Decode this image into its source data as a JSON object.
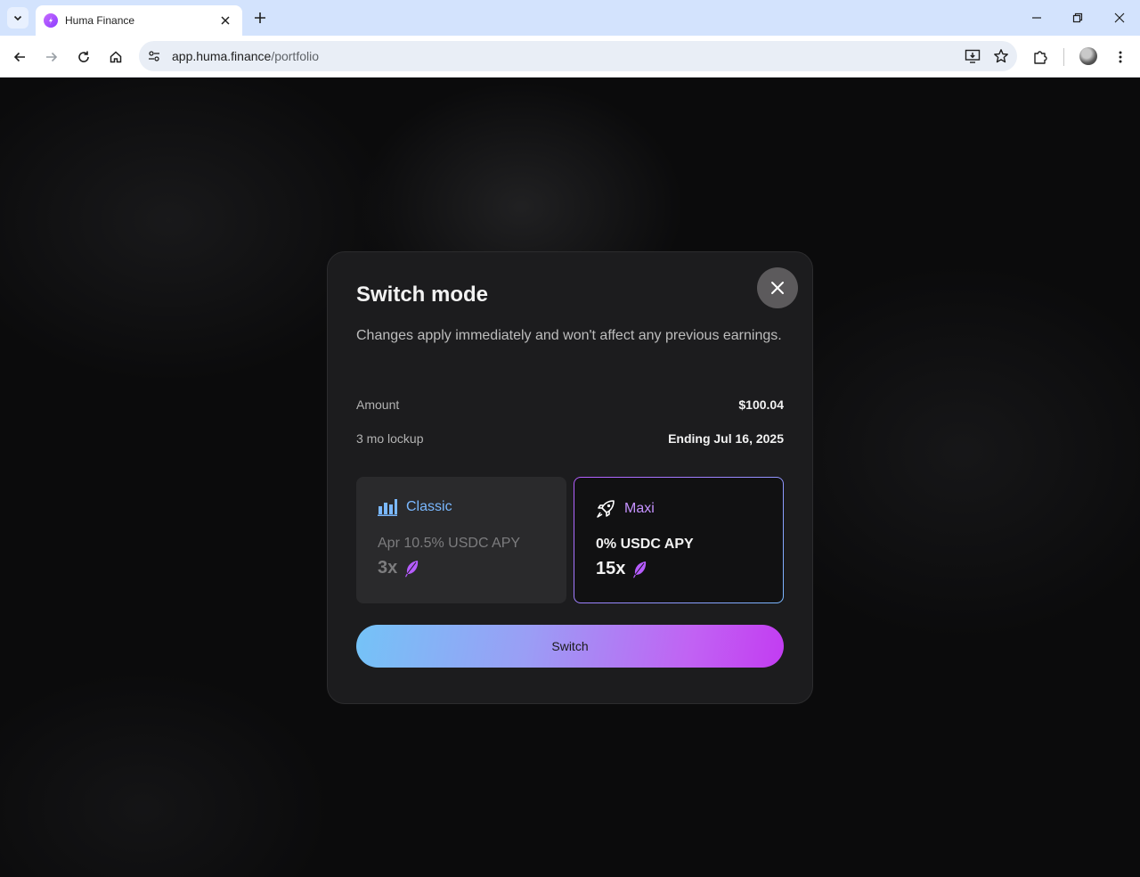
{
  "browser": {
    "tab_title": "Huma Finance",
    "url_host": "app.huma.finance",
    "url_path": "/portfolio"
  },
  "modal": {
    "title": "Switch mode",
    "description": "Changes apply immediately and won't affect any previous earnings.",
    "rows": [
      {
        "label": "Amount",
        "value": "$100.04"
      },
      {
        "label": "3 mo lockup",
        "value": "Ending Jul 16, 2025"
      }
    ],
    "modes": [
      {
        "name": "Classic",
        "apy": "Apr 10.5% USDC APY",
        "multiplier": "3x",
        "icon": "bar-chart-icon",
        "selected": false
      },
      {
        "name": "Maxi",
        "apy": "0% USDC APY",
        "multiplier": "15x",
        "icon": "rocket-icon",
        "selected": true
      }
    ],
    "button_label": "Switch"
  },
  "colors": {
    "classic_accent": "#7ab8ff",
    "maxi_accent": "#c592ff",
    "button_gradient_start": "#74c3f7",
    "button_gradient_end": "#c23cf2",
    "feather": "#b65cff"
  }
}
